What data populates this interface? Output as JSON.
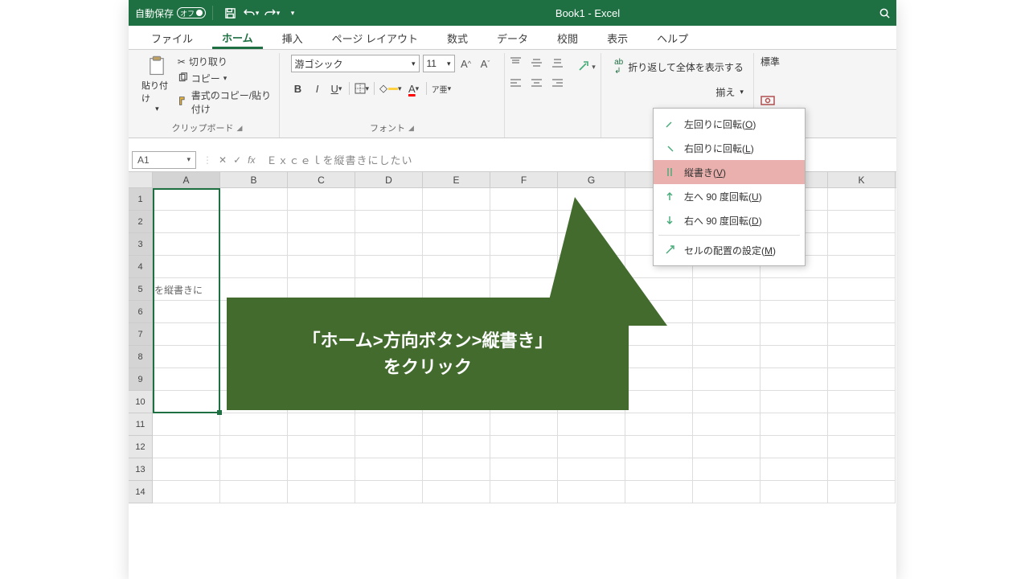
{
  "titlebar": {
    "autosave_label": "自動保存",
    "autosave_state": "オフ",
    "doc_title": "Book1  -  Excel"
  },
  "tabs": [
    "ファイル",
    "ホーム",
    "挿入",
    "ページ レイアウト",
    "数式",
    "データ",
    "校閲",
    "表示",
    "ヘルプ"
  ],
  "active_tab": 1,
  "ribbon": {
    "clipboard": {
      "paste": "貼り付け",
      "cut": "切り取り",
      "copy": "コピー",
      "formatpainter": "書式のコピー/貼り付け",
      "group_label": "クリップボード"
    },
    "font": {
      "font_name": "游ゴシック",
      "font_size": "11",
      "group_label": "フォント"
    },
    "orientation_menu": {
      "rotate_ccw": "左回りに回転(O)",
      "rotate_cw": "右回りに回転(L)",
      "vertical": "縦書き(V)",
      "rotate_up": "左へ 90 度回転(U)",
      "rotate_down": "右へ 90 度回転(D)",
      "format": "セルの配置の設定(M)"
    },
    "wrap": {
      "wrap_text": "折り返して全体を表示する",
      "merge_suffix": "揃え"
    },
    "number": {
      "label": "標準"
    }
  },
  "formula_bar": {
    "cell_ref": "A1",
    "fx": "fx",
    "content": "Ｅｘｃｅｌを縦書きにしたい"
  },
  "columns": [
    "A",
    "B",
    "C",
    "D",
    "E",
    "F",
    "G",
    "",
    "",
    "",
    "K"
  ],
  "rows": [
    "1",
    "2",
    "3",
    "4",
    "5",
    "6",
    "7",
    "8",
    "9",
    "10",
    "11",
    "12",
    "13",
    "14"
  ],
  "cell_a_visible": "を縦書きに",
  "callout": {
    "line1": "「ホーム>方向ボタン>縦書き」",
    "line2": "をクリック"
  }
}
